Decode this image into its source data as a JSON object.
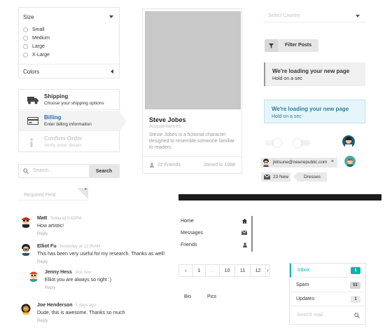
{
  "size_filter": {
    "title": "Size",
    "options": [
      "Small",
      "Medium",
      "Large",
      "X-Large"
    ],
    "colors_title": "Colors"
  },
  "steps": [
    {
      "title": "Shipping",
      "desc": "Choose your shipping options",
      "icon": "truck-icon"
    },
    {
      "title": "Billing",
      "desc": "Enter billing information",
      "icon": "credit-card-icon"
    },
    {
      "title": "Confirm Order",
      "desc": "Verify order details",
      "icon": "info-icon"
    }
  ],
  "search": {
    "placeholder": "Search...",
    "button": "Search"
  },
  "required_field": {
    "placeholder": "Required Field",
    "marker": "*"
  },
  "comments": [
    {
      "author": "Matt",
      "time": "Today at 5:42PM",
      "text": "How artistic!",
      "reply": "Reply"
    },
    {
      "author": "Elliot Fu",
      "time": "Yesterday at 12:30AM",
      "text": "This has been very useful for my research. Thanks as well!",
      "reply": "Reply"
    },
    {
      "author": "Jenny Hess",
      "time": "Just now",
      "text": "Elliot you are always so right :)",
      "reply": "Reply"
    },
    {
      "author": "Joe Henderson",
      "time": "5 days ago",
      "text": "Dude, this is awesome. Thanks so much",
      "reply": "Reply"
    }
  ],
  "card": {
    "name": "Steve Jobes",
    "meta": "Acquaintances",
    "description": "Stevie Jobes is a fictional character designed to resemble someone familiar to readers.",
    "friends": "22 Friends",
    "joined": "Joined in 1998"
  },
  "progress": {
    "percent": 100
  },
  "vertical_menu": [
    {
      "label": "Home",
      "icon": "home-icon"
    },
    {
      "label": "Messages",
      "icon": "mail-icon"
    },
    {
      "label": "Friends",
      "icon": "user-icon"
    }
  ],
  "pagination": [
    "‹",
    "1",
    "...",
    "10",
    "11",
    "12",
    "›"
  ],
  "tabs": [
    "Bio",
    "Pics"
  ],
  "country_select": {
    "placeholder": "Select Country"
  },
  "filter_button": {
    "label": "Filter Posts",
    "icon": "filter-icon"
  },
  "messages": [
    {
      "header": "We're loading your new page",
      "sub": "Hold on a sec"
    },
    {
      "header": "We're loading your new page",
      "sub": "Hold on a sec"
    }
  ],
  "email_tag": {
    "label": "jkitsune@newrepublic.com",
    "close": "×"
  },
  "new_tag": {
    "label": "23 New"
  },
  "dresses_tag": {
    "label": "Dresses"
  },
  "inbox_menu": [
    {
      "label": "Inbox",
      "count": "1",
      "color": "#00b5ad",
      "text_color": "#ffffff"
    },
    {
      "label": "Spam",
      "count": "51",
      "color": "#d6d6d6",
      "text_color": "#333333"
    },
    {
      "label": "Updates",
      "count": "1",
      "color": "#e8e8e8",
      "text_color": "#333333"
    }
  ],
  "inbox_search": {
    "placeholder": "Search mail..."
  },
  "colors": {
    "teal": "#00b5ad",
    "blue_link": "#2a6bb5",
    "info": "#2a7f9c",
    "progress": "#1b1c1d"
  }
}
